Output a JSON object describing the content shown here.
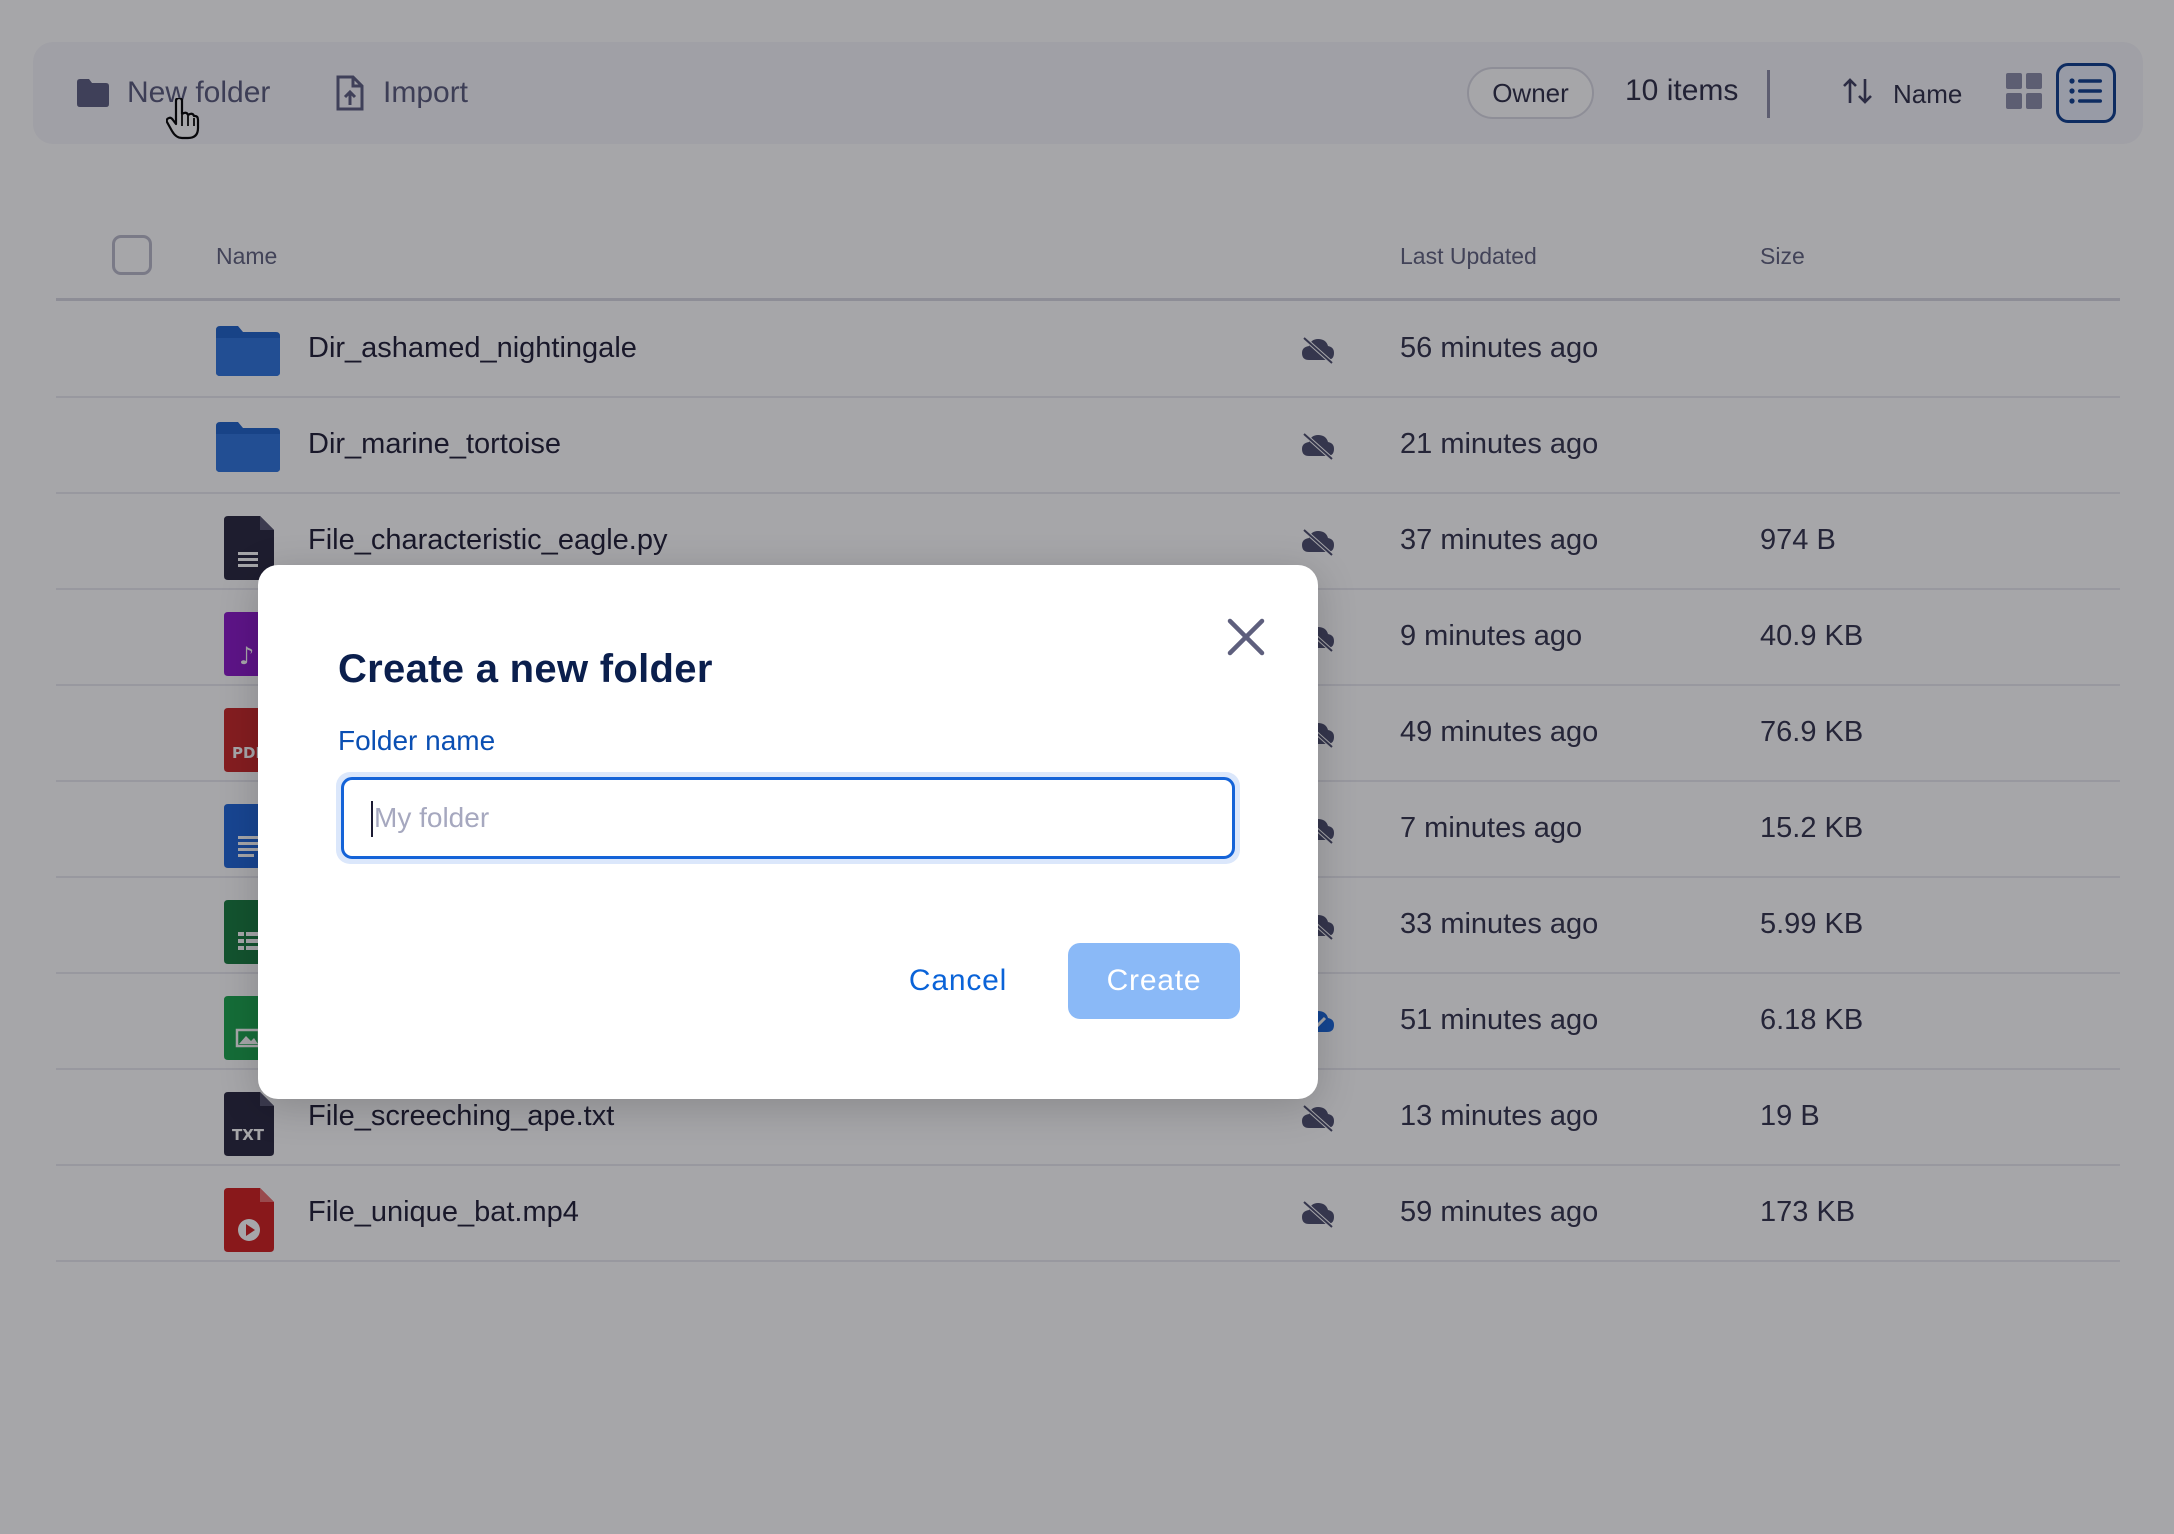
{
  "toolbar": {
    "new_folder_label": "New folder",
    "import_label": "Import",
    "owner_filter": "Owner",
    "items_count": "10 items",
    "sort_label": "Name"
  },
  "table": {
    "columns": {
      "name": "Name",
      "last_updated": "Last Updated",
      "size": "Size"
    },
    "rows": [
      {
        "name": "Dir_ashamed_nightingale",
        "type": "folder",
        "updated": "56 minutes ago",
        "size": "",
        "synced": false
      },
      {
        "name": "Dir_marine_tortoise",
        "type": "folder",
        "updated": "21 minutes ago",
        "size": "",
        "synced": false
      },
      {
        "name": "File_characteristic_eagle.py",
        "type": "code",
        "updated": "37 minutes ago",
        "size": "974 B",
        "synced": false
      },
      {
        "name": "",
        "type": "audio",
        "updated": "9 minutes ago",
        "size": "40.9 KB",
        "synced": false
      },
      {
        "name": "",
        "type": "pdf",
        "icon_text": "PDF",
        "updated": "49 minutes ago",
        "size": "76.9 KB",
        "synced": false
      },
      {
        "name": "",
        "type": "doc",
        "updated": "7 minutes ago",
        "size": "15.2 KB",
        "synced": false
      },
      {
        "name": "",
        "type": "sheet",
        "updated": "33 minutes ago",
        "size": "5.99 KB",
        "synced": false
      },
      {
        "name": "",
        "type": "image",
        "updated": "51 minutes ago",
        "size": "6.18 KB",
        "synced": true
      },
      {
        "name": "File_screeching_ape.txt",
        "type": "txt",
        "icon_text": "TXT",
        "updated": "13 minutes ago",
        "size": "19 B",
        "synced": false
      },
      {
        "name": "File_unique_bat.mp4",
        "type": "video",
        "updated": "59 minutes ago",
        "size": "173 KB",
        "synced": false
      }
    ]
  },
  "modal": {
    "title": "Create a new folder",
    "field_label": "Folder name",
    "field_value": "",
    "field_placeholder": "My folder",
    "cancel_label": "Cancel",
    "create_label": "Create"
  },
  "colors": {
    "accent": "#1463d8",
    "folder": "#1a5fc9",
    "create_disabled": "#8ab9f7",
    "overlay": "rgba(20,20,28,0.38)"
  },
  "icons": {
    "new_folder": "folder-icon",
    "import": "import-file-icon",
    "sort": "sort-arrows-icon",
    "grid_view": "grid-view-icon",
    "list_view": "list-view-icon",
    "close": "close-icon",
    "not_synced": "cloud-off-icon",
    "synced": "cloud-check-icon"
  }
}
